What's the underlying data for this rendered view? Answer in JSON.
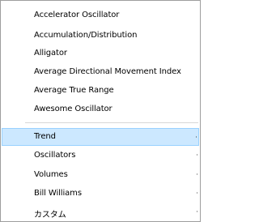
{
  "menu": {
    "indicators": [
      {
        "label": "Accelerator Oscillator"
      },
      {
        "label": "Accumulation/Distribution"
      },
      {
        "label": "Alligator"
      },
      {
        "label": "Average Directional Movement Index"
      },
      {
        "label": "Average True Range"
      },
      {
        "label": "Awesome Oscillator"
      }
    ],
    "categories": [
      {
        "label": "Trend",
        "selected": true
      },
      {
        "label": "Oscillators"
      },
      {
        "label": "Volumes"
      },
      {
        "label": "Bill Williams"
      },
      {
        "label": "カスタム"
      }
    ],
    "colors": {
      "selected_bg": "#cce8ff",
      "selected_border": "#99d1ff",
      "border": "#9e9e9e",
      "separator": "#d7d7d7"
    }
  }
}
